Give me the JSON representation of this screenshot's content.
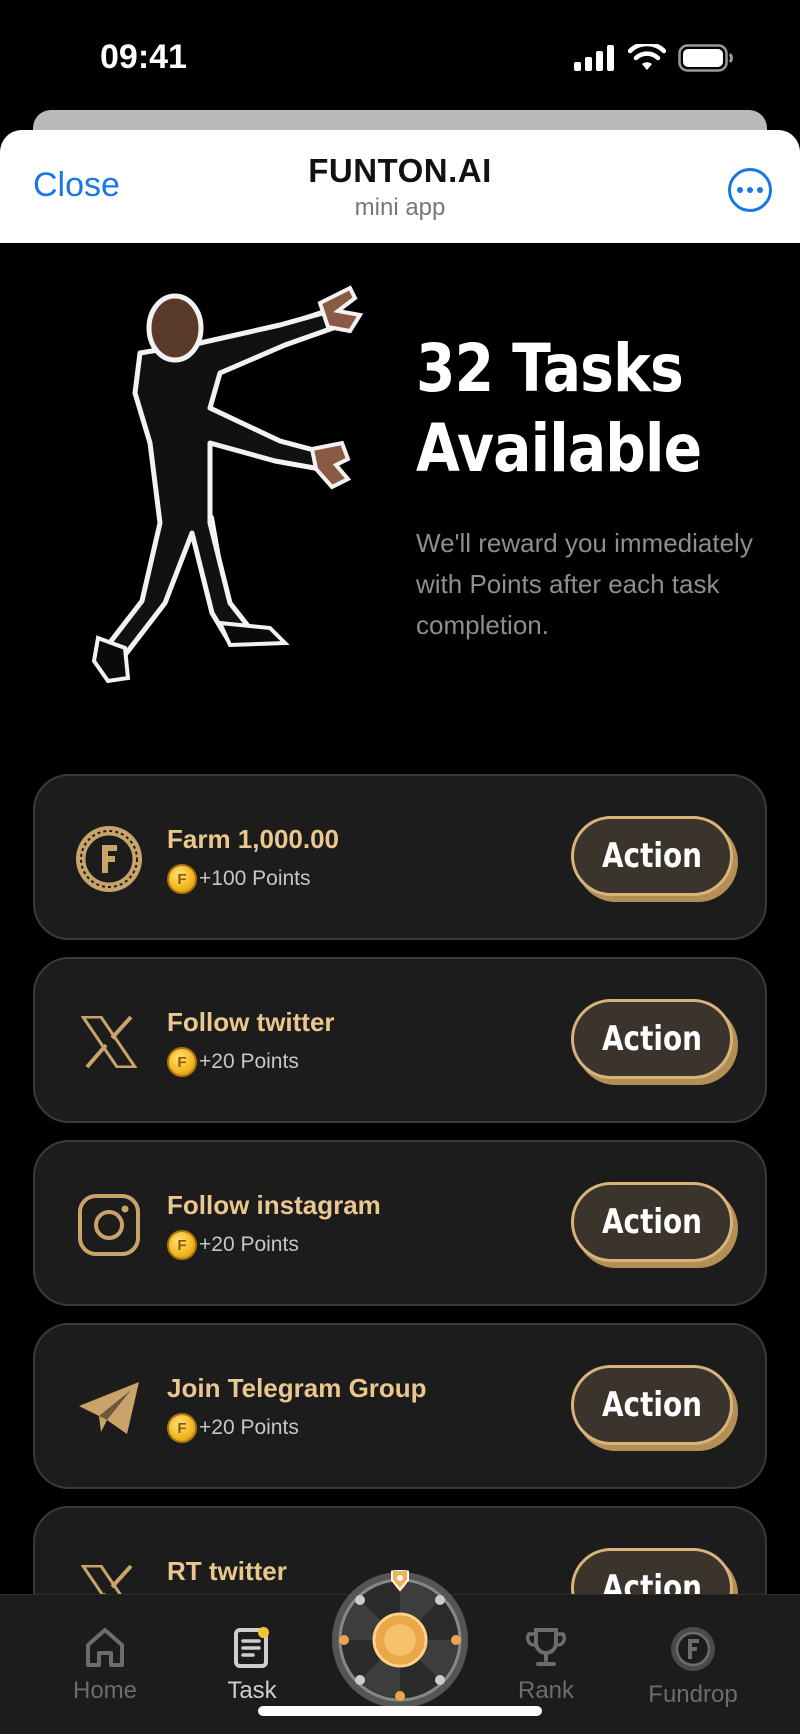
{
  "status_bar": {
    "time": "09:41"
  },
  "header": {
    "close_label": "Close",
    "title": "FUNTON.AI",
    "subtitle": "mini app"
  },
  "hero": {
    "title": "32 Tasks Available",
    "description": "We'll reward you immediately with Points after each task completion."
  },
  "tasks": [
    {
      "name": "Farm 1,000.00",
      "reward": "+100 Points",
      "action_label": "Action",
      "icon": "funton-coin-icon"
    },
    {
      "name": "Follow twitter",
      "reward": "+20 Points",
      "action_label": "Action",
      "icon": "x-logo-icon"
    },
    {
      "name": "Follow instagram",
      "reward": "+20 Points",
      "action_label": "Action",
      "icon": "instagram-icon"
    },
    {
      "name": "Join Telegram Group",
      "reward": "+20 Points",
      "action_label": "Action",
      "icon": "telegram-icon"
    },
    {
      "name": "RT twitter",
      "reward": "",
      "action_label": "Action",
      "icon": "x-logo-icon"
    }
  ],
  "nav": {
    "home": "Home",
    "task": "Task",
    "rank": "Rank",
    "fundrop": "Fundrop"
  },
  "colors": {
    "accent_gold": "#e9c78f",
    "link_blue": "#1677e5",
    "card_bg": "#1c1c1c"
  }
}
